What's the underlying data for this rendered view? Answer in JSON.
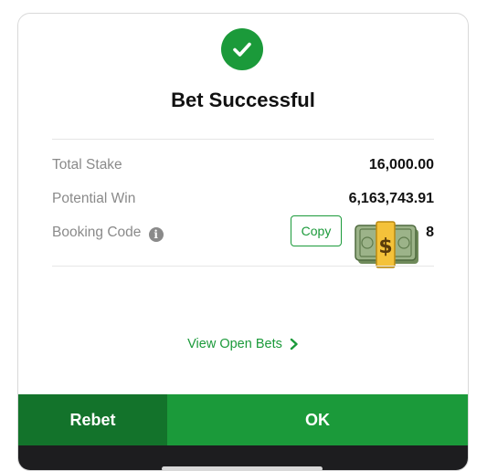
{
  "dialog": {
    "title": "Bet Successful",
    "icon": "check-circle-icon",
    "accent_color": "#1b9a3a"
  },
  "details": {
    "total_stake_label": "Total Stake",
    "total_stake_value": "16,000.00",
    "potential_win_label": "Potential Win",
    "potential_win_value": "6,163,743.91",
    "booking_code_label": "Booking Code",
    "booking_code_visible_tail": "8",
    "copy_label": "Copy"
  },
  "links": {
    "view_open_bets": "View Open Bets"
  },
  "footer": {
    "rebet_label": "Rebet",
    "ok_label": "OK"
  }
}
